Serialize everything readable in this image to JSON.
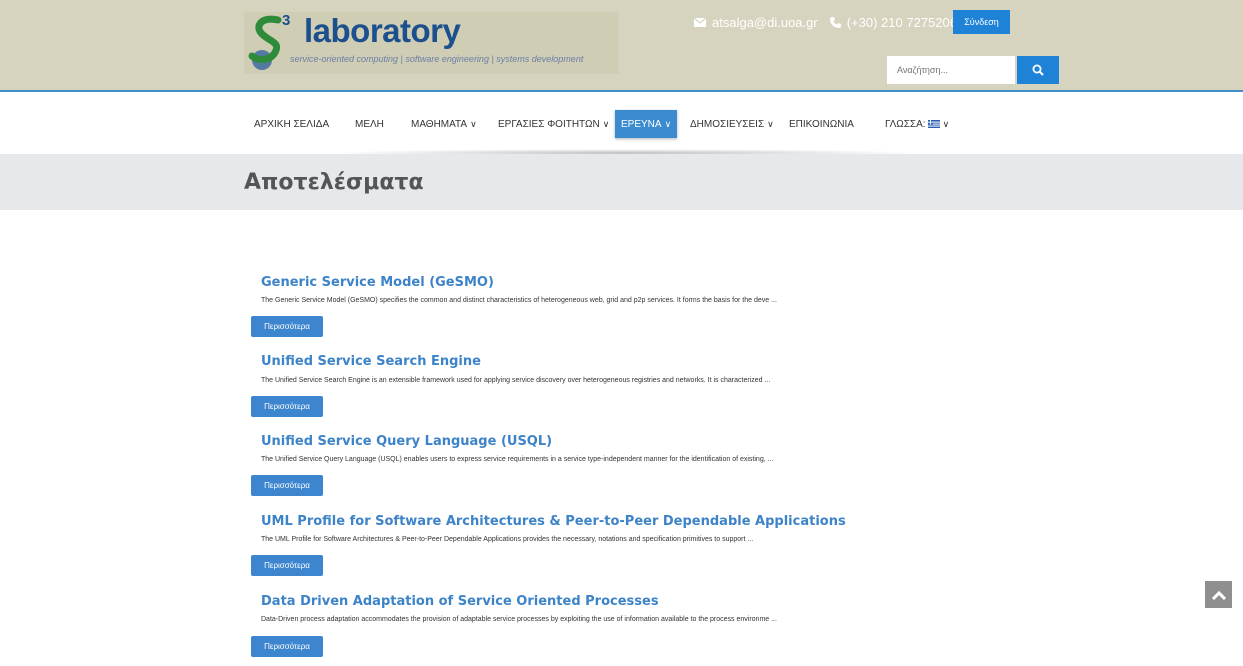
{
  "header": {
    "logo_superscript": "3",
    "logo_text": "laboratory",
    "logo_tagline": "service-oriented computing | software engineering | systems development",
    "email": "atsalga@di.uoa.gr",
    "phone": "(+30) 210 7275206",
    "login_label": "Σύνδεση",
    "search_placeholder": "Αναζήτηση...",
    "colors": {
      "band": "#d6d3be",
      "accent": "#1e82d6"
    }
  },
  "nav": {
    "items": [
      {
        "label": "ΑΡΧΙΚΗ ΣΕΛΙΔΑ"
      },
      {
        "label": "ΜΕΛΗ"
      },
      {
        "label": "ΜΑΘΗΜΑΤΑ"
      },
      {
        "label": "ΕΡΓΑΣΙΕΣ ΦΟΙΤΗΤΩΝ"
      },
      {
        "label": "ΕΡΕΥΝΑ"
      },
      {
        "label": "ΔΗΜΟΣΙΕΥΣΕΙΣ"
      },
      {
        "label": "ΕΠΙΚΟΙΝΩΝΙΑ"
      },
      {
        "label": "ΓΛΩΣΣΑ:"
      }
    ],
    "active": "ΕΡΕΥΝΑ"
  },
  "page": {
    "title": "Αποτελέσματα"
  },
  "results": [
    {
      "title": "Generic Service Model (GeSMO)",
      "desc": "The Generic Service Model (GeSMO) specifies the common and distinct characteristics of heterogeneous web, grid and p2p services. It forms the basis for the deve ...",
      "more": "Περισσότερα"
    },
    {
      "title": "Unified Service Search Engine",
      "desc": "The Unified Service Search Engine is an extensible framework used for applying service discovery over heterogeneous registries and networks. It is characterized ...",
      "more": "Περισσότερα"
    },
    {
      "title": "Unified Service Query Language (USQL)",
      "desc": "The Unified Service Query Language (USQL) enables users to express service requirements in a service type-independent manner for the identification of existing, ...",
      "more": "Περισσότερα"
    },
    {
      "title": "UML Profile for Software Architectures & Peer-to-Peer Dependable Applications",
      "desc": "The UML Profile for Software Architectures & Peer-to-Peer Dependable Applications provides the necessary, notations and specification primitives to support ...",
      "more": "Περισσότερα"
    },
    {
      "title": "Data Driven Adaptation of Service Oriented Processes",
      "desc": "Data-Driven process adaptation accommodates the provision of adaptable service processes by exploiting the use of information available to the process environme ...",
      "more": "Περισσότερα"
    }
  ],
  "icons": {
    "email": "envelope-icon",
    "phone": "phone-icon",
    "search": "search-icon",
    "scroll_top": "chevron-up-icon",
    "language_flag": "greek-flag-icon"
  }
}
